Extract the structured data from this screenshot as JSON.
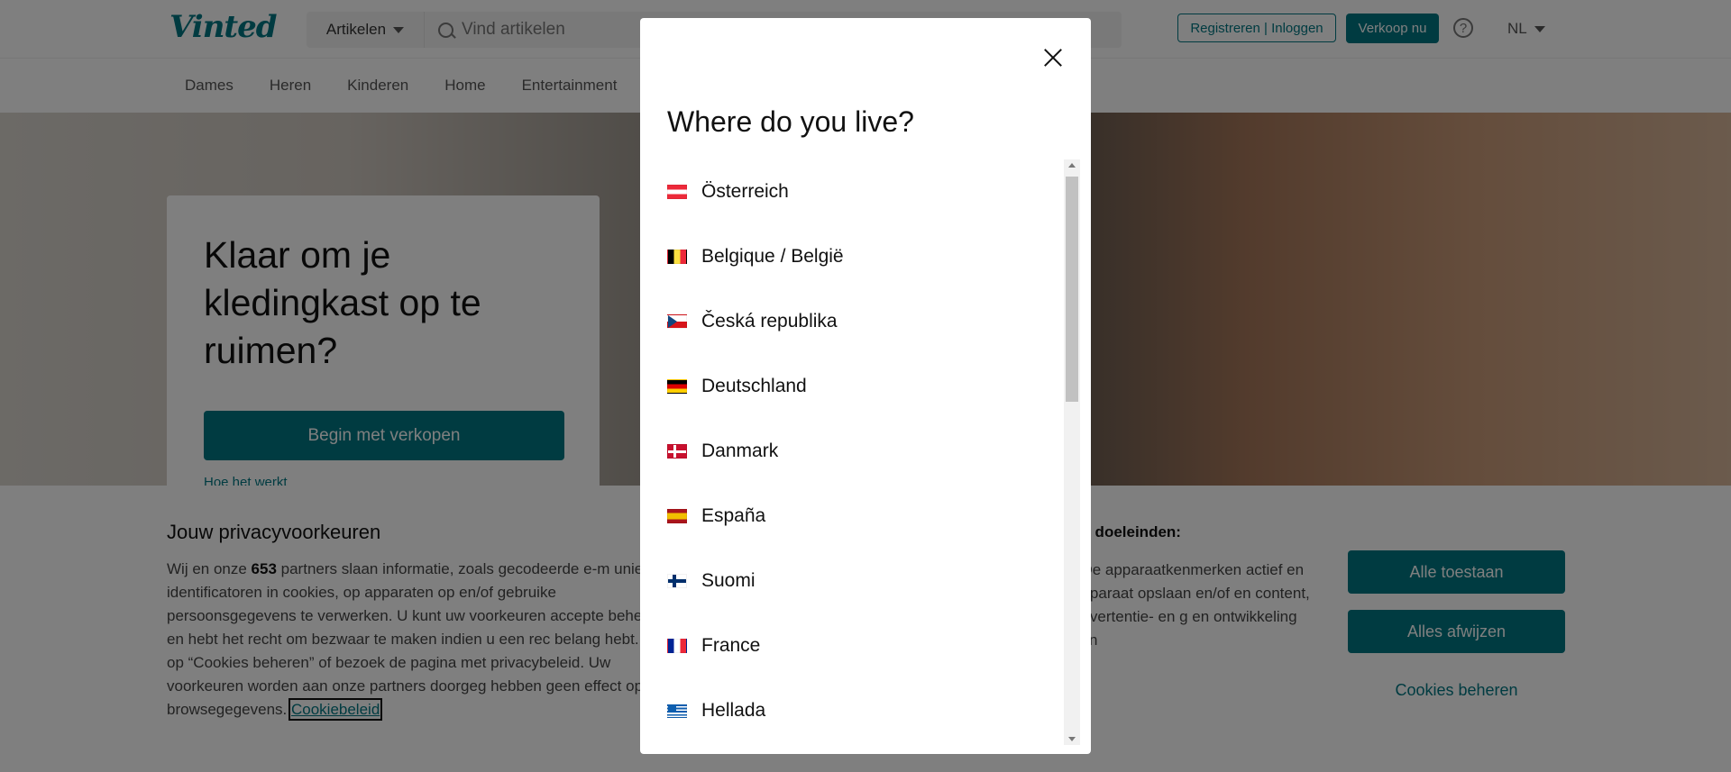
{
  "header": {
    "logo": "Vinted",
    "category_select": "Artikelen",
    "search_placeholder": "Vind artikelen",
    "auth_button": "Registreren | Inloggen",
    "sell_button": "Verkoop nu",
    "help_icon": "question-circle-icon",
    "language": "NL"
  },
  "nav": {
    "items": [
      "Dames",
      "Heren",
      "Kinderen",
      "Home",
      "Entertainment"
    ]
  },
  "hero": {
    "title": "Klaar om je kledingkast op te ruimen?",
    "cta": "Begin met verkopen",
    "link": "Hoe het werkt"
  },
  "consent": {
    "title": "Jouw privacyvoorkeuren",
    "text_before": "Wij en onze ",
    "partners_count": "653",
    "text_after": " partners slaan informatie, zoals gecodeerde e-m unieke identificatoren in cookies, op apparaten op en/of gebruike persoonsgegevens te verwerken. U kunt uw voorkeuren accepte beheren, en hebt het recht om bezwaar te maken indien u een rec belang hebt. Klik op “Cookies beheren” of bezoek de pagina met privacybeleid. Uw voorkeuren worden aan onze partners doorgeg hebben geen effect op browsegegevens. ",
    "policy_link": "Cookiebeleid",
    "purposes_title": "de doeleinden:",
    "purposes_text": ". De apparaatkenmerken actief en apparaat opslaan en/of en content, advertentie- en g en ontwikkeling van",
    "accept_all": "Alle toestaan",
    "reject_all": "Alles afwijzen",
    "manage": "Cookies beheren"
  },
  "modal": {
    "title": "Where do you live?",
    "close_icon": "close-icon",
    "countries": [
      {
        "name": "Österreich",
        "flag": "at"
      },
      {
        "name": "Belgique / België",
        "flag": "be"
      },
      {
        "name": "Česká republika",
        "flag": "cz"
      },
      {
        "name": "Deutschland",
        "flag": "de"
      },
      {
        "name": "Danmark",
        "flag": "dk"
      },
      {
        "name": "España",
        "flag": "es"
      },
      {
        "name": "Suomi",
        "flag": "fi"
      },
      {
        "name": "France",
        "flag": "fr"
      },
      {
        "name": "Hellada",
        "flag": "gr"
      }
    ]
  },
  "colors": {
    "brand": "#007782",
    "overlay": "rgba(0,0,0,0.5)"
  }
}
